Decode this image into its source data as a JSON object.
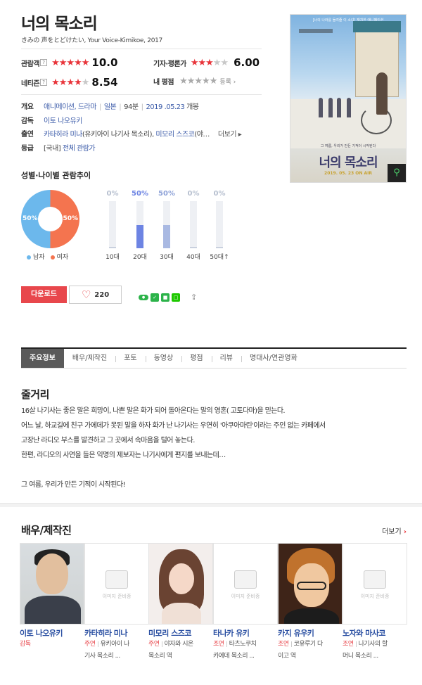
{
  "movie": {
    "title": "너의 목소리",
    "subtitle": "きみの 声をとどけたい, Your Voice-Kimikoe, 2017"
  },
  "ratings": {
    "audience": {
      "label": "관람객",
      "stars_filled": 5,
      "score": "10.0"
    },
    "critic": {
      "label": "기자·평론가",
      "stars_filled": 3,
      "score": "6.00"
    },
    "netizen": {
      "label": "네티즌",
      "stars_filled": 4,
      "score": "8.54"
    },
    "mine": {
      "label": "내 평점",
      "stars_filled": 0,
      "action": "등록"
    }
  },
  "info": {
    "overview_label": "개요",
    "genre": "애니메이션, 드라마",
    "country": "일본",
    "runtime": "94분",
    "release": "2019 .05.23",
    "release_suffix": "개봉",
    "director_label": "감독",
    "director": "이토 나오유키",
    "cast_label": "출연",
    "cast_1": "카타히라 미나",
    "cast_1_role": "(유키아이 나기사 목소리),",
    "cast_2": "미모리 스즈코",
    "cast_2_rest": "(야…",
    "more": "더보기",
    "grade_label": "등급",
    "grade_prefix": "[국내]",
    "grade": "전체 관람가"
  },
  "poster": {
    "top_text": "[너의 나라를 들려줄 이 소녀] 재치한 애니메이션",
    "mid_text": "그 여름, 우리가 만든 기적이 시작된다",
    "title": "너의 목소리",
    "date": "2019. 05. 23 ON AIR"
  },
  "demographics": {
    "heading": "성별·나이별 관람추이",
    "gender": {
      "male_pct": "50%",
      "female_pct": "50%",
      "male_label": "남자",
      "female_label": "여자"
    },
    "ages": [
      {
        "label": "10대",
        "pct": "0%",
        "value": 0
      },
      {
        "label": "20대",
        "pct": "50%",
        "value": 50
      },
      {
        "label": "30대",
        "pct": "50%",
        "value": 50
      },
      {
        "label": "40대",
        "pct": "0%",
        "value": 0
      },
      {
        "label": "50대↑",
        "pct": "0%",
        "value": 0
      }
    ]
  },
  "actions": {
    "download": "다운로드",
    "likes": "220"
  },
  "tabs": [
    "주요정보",
    "배우/제작진",
    "포토",
    "동영상",
    "평점",
    "리뷰",
    "명대사/연관영화"
  ],
  "synopsis": {
    "heading": "줄거리",
    "lines": [
      "16살 나기사는 좋은 말은 희망이, 나쁜 말은 화가 되어 돌아온다는 말의 영혼( 고토다마)을 믿는다.",
      " 어느 날, 하교길에 친구 가에데가 못된 말을 하자 화가 난 나기사는 우연히 '아쿠아마린'이라는 주인 없는 카페에서",
      "고장난 라디오 부스를 발견하고 그 곳에서 속마음을 털어 놓는다.",
      " 한편, 라디오의 사연을 들은 익명의 제보자는 나기사에게 편지를 보내는데…",
      "",
      " 그 여름, 우리가 만든 기적이 시작된다!"
    ]
  },
  "cast_section": {
    "heading": "배우/제작진",
    "more": "더보기",
    "no_image": "이미지 준비중",
    "people": [
      {
        "name": "이토 나오유키",
        "role_type": "감독",
        "role": "",
        "role_2": ""
      },
      {
        "name": "카타히라 미나",
        "role_type": "주연",
        "role": "유키아이 나",
        "role_2": "기사 목소리 ..."
      },
      {
        "name": "미모리 스즈코",
        "role_type": "주연",
        "role": "야자와 시온",
        "role_2": "목소리 역"
      },
      {
        "name": "타나카 유키",
        "role_type": "조연",
        "role": "타츠노쿠치",
        "role_2": "카에데 목소리 ..."
      },
      {
        "name": "카지 유우키",
        "role_type": "조연",
        "role": "코유루기 다",
        "role_2": "이고 역"
      },
      {
        "name": "노자와 마사코",
        "role_type": "조연",
        "role": "나기사의 할",
        "role_2": "머니 목소리 ..."
      }
    ]
  },
  "colors": {
    "accent": "#e8343a",
    "link": "#3a5aa8",
    "male": "#6cb8ec",
    "female": "#f4744f",
    "bar_fill": "#6d84e3",
    "bar_fill_2": "#a9b9e2"
  }
}
